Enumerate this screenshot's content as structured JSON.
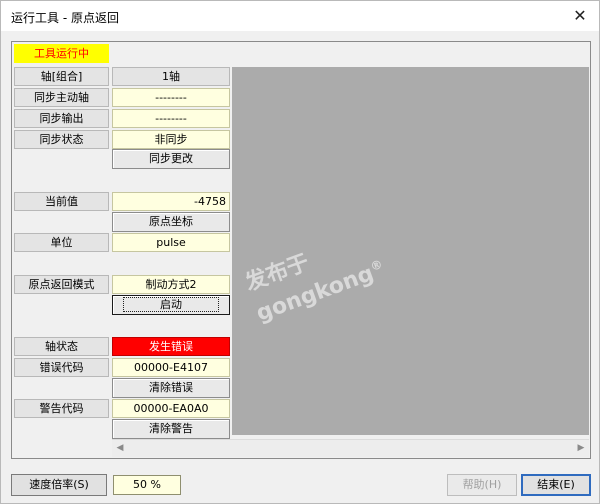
{
  "window": {
    "title": "运行工具 - 原点返回",
    "close_glyph": "✕"
  },
  "status_banner": "工具运行中",
  "rows": {
    "axis_label": "轴[组合]",
    "axis_value": "1轴",
    "sync_master_label": "同步主动轴",
    "sync_master_value": "--------",
    "sync_output_label": "同步输出",
    "sync_output_value": "--------",
    "sync_state_label": "同步状态",
    "sync_state_value": "非同步",
    "sync_change_button": "同步更改",
    "current_value_label": "当前值",
    "current_value": "-4758",
    "origin_coord_button": "原点坐标",
    "unit_label": "单位",
    "unit_value": "pulse",
    "return_mode_label": "原点返回模式",
    "return_mode_value": "制动方式2",
    "start_button": "启动",
    "axis_state_label": "轴状态",
    "axis_state_value": "发生错误",
    "error_code_label": "错误代码",
    "error_code_value": "00000-E4107",
    "clear_error_button": "清除错误",
    "warning_code_label": "警告代码",
    "warning_code_value": "00000-EA0A0",
    "clear_warning_button": "清除警告"
  },
  "watermark": {
    "line1": "发布于",
    "line2": "gongkong",
    "mark": "®"
  },
  "footer": {
    "speed_rate_button": "速度倍率(S)",
    "speed_rate_value": "50 %",
    "help_button": "帮助(H)",
    "end_button": "结束(E)"
  },
  "colors": {
    "banner_bg": "#ffff00",
    "banner_text": "#ff0000",
    "error_bg": "#ff0000",
    "panel_gray": "#ababab"
  }
}
